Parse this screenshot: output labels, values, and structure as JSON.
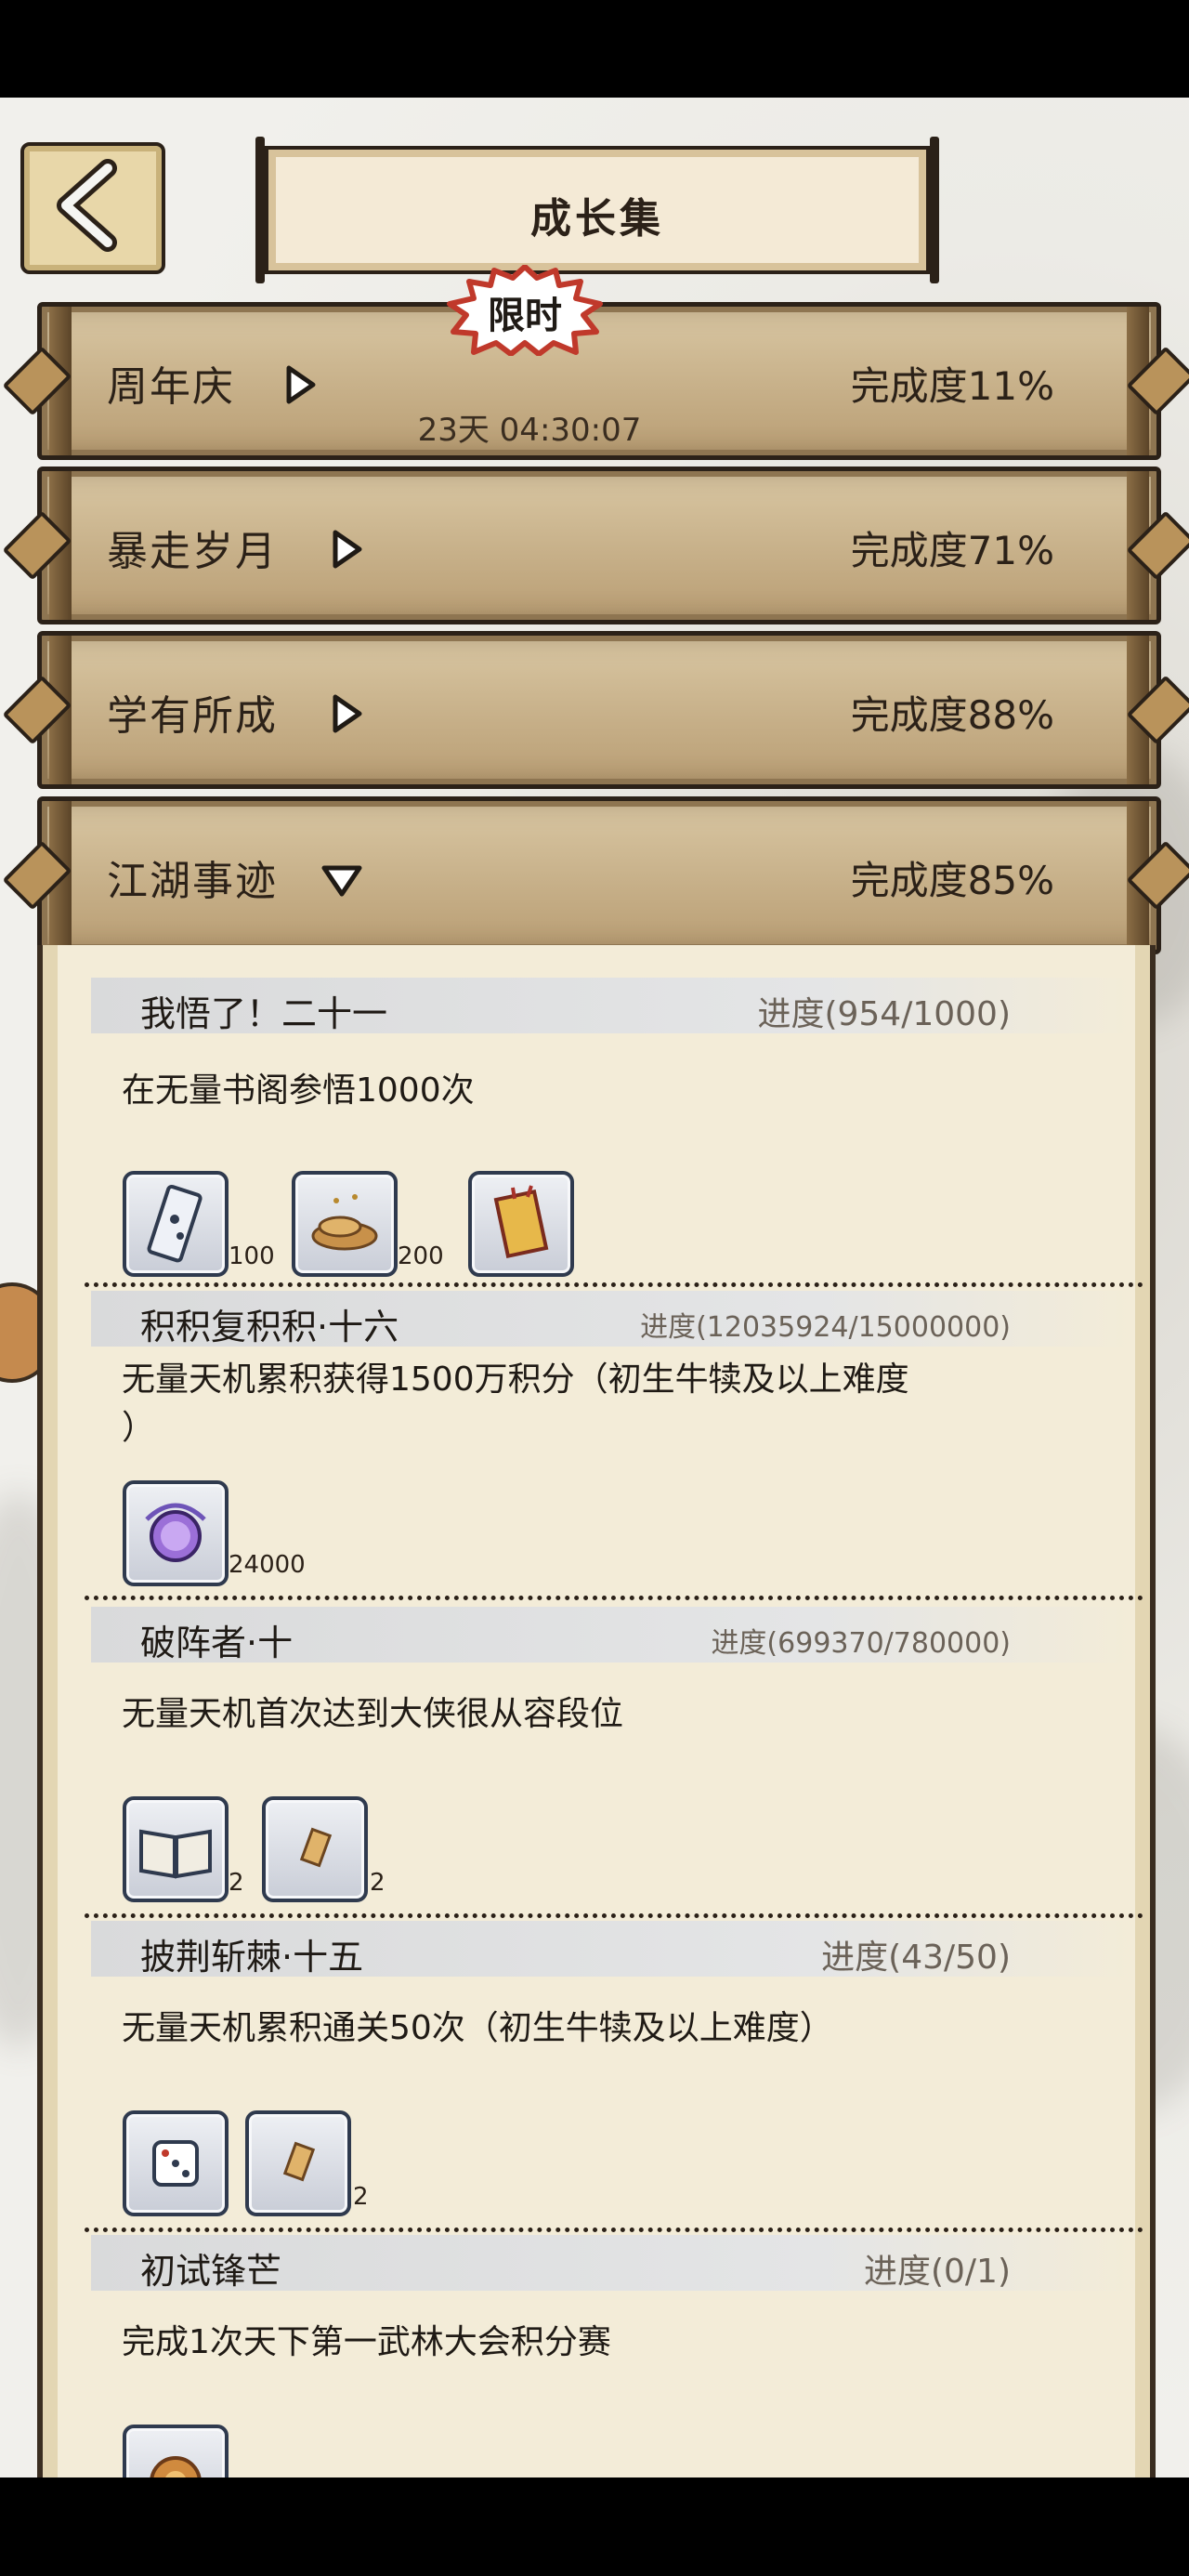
{
  "header": {
    "title": "成长集",
    "back_label": "back"
  },
  "categories": [
    {
      "name": "周年庆",
      "expanded": false,
      "completion": "完成度11%",
      "limited_badge": "限时",
      "countdown": "23天 04:30:07"
    },
    {
      "name": "暴走岁月",
      "expanded": false,
      "completion": "完成度71%"
    },
    {
      "name": "学有所成",
      "expanded": false,
      "completion": "完成度88%"
    },
    {
      "name": "江湖事迹",
      "expanded": true,
      "completion": "完成度85%"
    }
  ],
  "tasks": [
    {
      "name": "我悟了！二十一",
      "progress": "进度(954/1000)",
      "description": "在无量书阁参悟1000次",
      "rewards": [
        {
          "icon": "ticket-icon",
          "qty": "100"
        },
        {
          "icon": "gold-pile-icon",
          "qty": "200"
        },
        {
          "icon": "title-scroll-icon",
          "qty": ""
        }
      ]
    },
    {
      "name": "积积复积积·十六",
      "progress": "进度(12035924/15000000)",
      "description": "无量天机累积获得1500万积分（初生牛犊及以上难度\n）",
      "rewards": [
        {
          "icon": "purple-orb-icon",
          "qty": "24000"
        }
      ]
    },
    {
      "name": "破阵者·十",
      "progress": "进度(699370/780000)",
      "description": "无量天机首次达到大侠很从容段位",
      "rewards": [
        {
          "icon": "book-icon",
          "qty": "2"
        },
        {
          "icon": "scroll-fragment-icon",
          "qty": "2"
        }
      ]
    },
    {
      "name": "披荆斩棘·十五",
      "progress": "进度(43/50)",
      "description": "无量天机累积通关50次（初生牛犊及以上难度）",
      "rewards": [
        {
          "icon": "dice-icon",
          "qty": ""
        },
        {
          "icon": "scroll-fragment-icon",
          "qty": "2"
        }
      ]
    },
    {
      "name": "初试锋芒",
      "progress": "进度(0/1)",
      "description": "完成1次天下第一武林大会积分赛",
      "rewards": [
        {
          "icon": "medal-icon",
          "qty": ""
        }
      ]
    }
  ]
}
